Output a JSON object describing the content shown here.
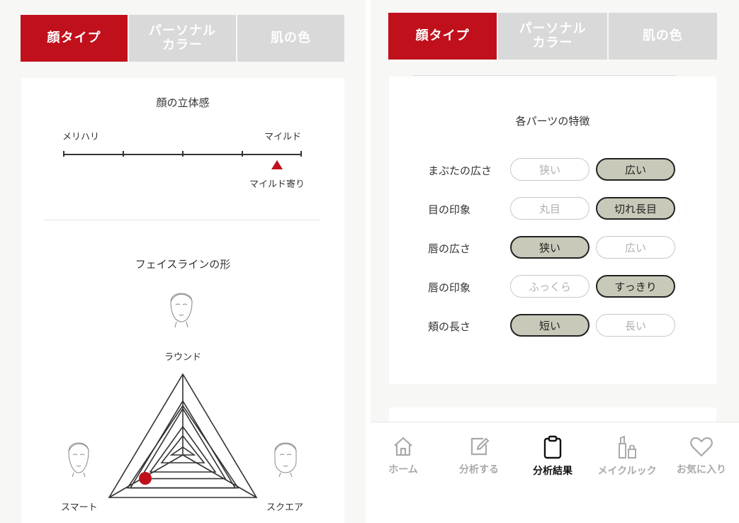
{
  "tabs": {
    "face_type": "顔タイプ",
    "personal_color": "パーソナル\nカラー",
    "skin_color": "肌の色"
  },
  "colors": {
    "accent": "#c0101c",
    "tab_inactive": "#d9d9d9",
    "pill_selected": "#c9c9b9"
  },
  "face_3d": {
    "title": "顔の立体感",
    "left_label": "メリハリ",
    "right_label": "マイルド",
    "result_label": "マイルド寄り",
    "position_fraction": 0.9
  },
  "face_line": {
    "title": "フェイスラインの形",
    "top_label": "ラウンド",
    "left_label": "スマート",
    "right_label": "スクエア"
  },
  "parts": {
    "title": "各パーツの特徴",
    "rows": [
      {
        "label": "まぶたの広さ",
        "left": "狭い",
        "right": "広い",
        "selected": "right"
      },
      {
        "label": "目の印象",
        "left": "丸目",
        "right": "切れ長目",
        "selected": "right"
      },
      {
        "label": "唇の広さ",
        "left": "狭い",
        "right": "広い",
        "selected": "left"
      },
      {
        "label": "唇の印象",
        "left": "ふっくら",
        "right": "すっきり",
        "selected": "right"
      },
      {
        "label": "頬の長さ",
        "left": "短い",
        "right": "長い",
        "selected": "left"
      }
    ]
  },
  "nav": {
    "home": "ホーム",
    "analyze": "分析する",
    "results": "分析結果",
    "makeup": "メイクルック",
    "favorites": "お気に入り"
  },
  "icons": [
    "home-icon",
    "edit-icon",
    "clipboard-icon",
    "lipstick-icon",
    "heart-icon"
  ]
}
